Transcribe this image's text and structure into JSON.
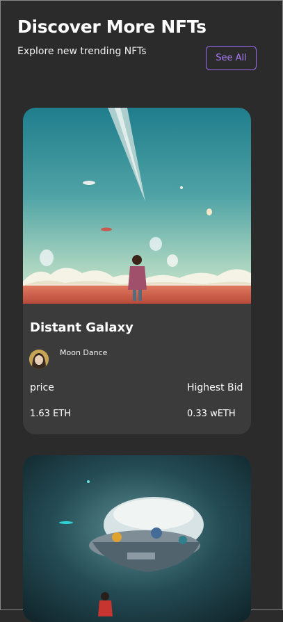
{
  "header": {
    "title": "Discover More NFTs",
    "subtitle": "Explore new trending NFTs",
    "see_all_label": "See All"
  },
  "cards": [
    {
      "name": "Distant Galaxy",
      "artist": "Moon Dance",
      "price_label": "price",
      "price_value": "1.63 ETH",
      "bid_label": "Highest Bid",
      "bid_value": "0.33 wETH"
    }
  ],
  "colors": {
    "background": "#2b2b2b",
    "card": "#3b3b3b",
    "accent": "#a97cf6"
  }
}
